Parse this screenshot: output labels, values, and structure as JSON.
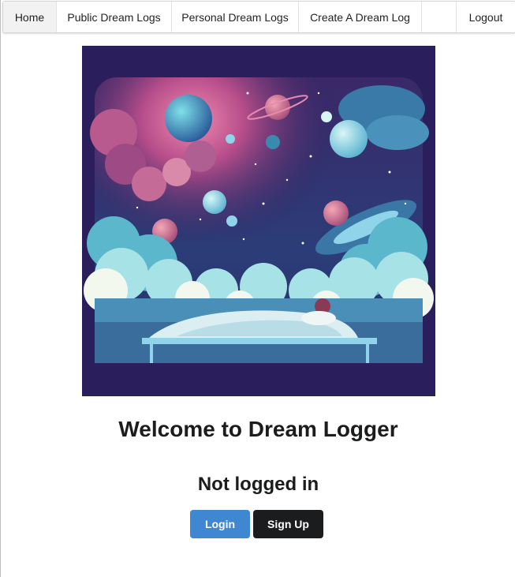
{
  "nav": {
    "items": [
      {
        "label": "Home",
        "active": true
      },
      {
        "label": "Public Dream Logs",
        "active": false
      },
      {
        "label": "Personal Dream Logs",
        "active": false
      },
      {
        "label": "Create A Dream Log",
        "active": false
      }
    ],
    "logout_label": "Logout"
  },
  "hero": {
    "image_icon": "dream-illustration-icon"
  },
  "main": {
    "title": "Welcome to Dream Logger",
    "status": "Not logged in",
    "login_label": "Login",
    "signup_label": "Sign Up"
  },
  "colors": {
    "primary": "#3f87d0",
    "secondary": "#1b1c1d",
    "hero_bg": "#2a1f5c"
  }
}
